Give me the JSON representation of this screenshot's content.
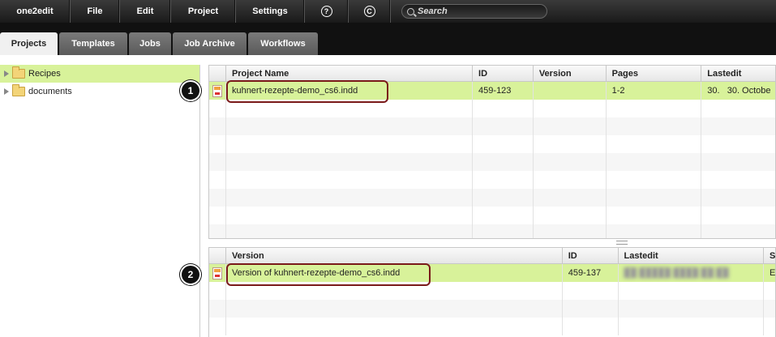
{
  "menu": {
    "items": [
      "one2edit",
      "File",
      "Edit",
      "Project",
      "Settings"
    ],
    "help_icon": "question-circle-icon",
    "copyright_icon": "copyright-circle-icon",
    "help_glyph": "?",
    "copyright_glyph": "C",
    "search_placeholder": "Search"
  },
  "tabs": [
    {
      "label": "Projects",
      "active": true
    },
    {
      "label": "Templates"
    },
    {
      "label": "Jobs"
    },
    {
      "label": "Job Archive"
    },
    {
      "label": "Workflows"
    }
  ],
  "tree": [
    {
      "label": "Recipes",
      "selected": true
    },
    {
      "label": "documents"
    }
  ],
  "projects_grid": {
    "headers": [
      "Project Name",
      "ID",
      "Version",
      "Pages",
      "Lastedit"
    ],
    "rows": [
      {
        "name": "kuhnert-rezepte-demo_cs6.indd",
        "id": "459-123",
        "version": "",
        "pages": "1-2",
        "lastedit": "30.   30. Octobe"
      }
    ]
  },
  "versions_grid": {
    "headers": [
      "Version",
      "ID",
      "Lastedit",
      "S"
    ],
    "rows": [
      {
        "version": "Version of kuhnert-rezepte-demo_cs6.indd",
        "id": "459-137",
        "lastedit": "██ █████ ████ ██:██",
        "s": "El"
      }
    ]
  },
  "callouts": [
    "1",
    "2"
  ]
}
